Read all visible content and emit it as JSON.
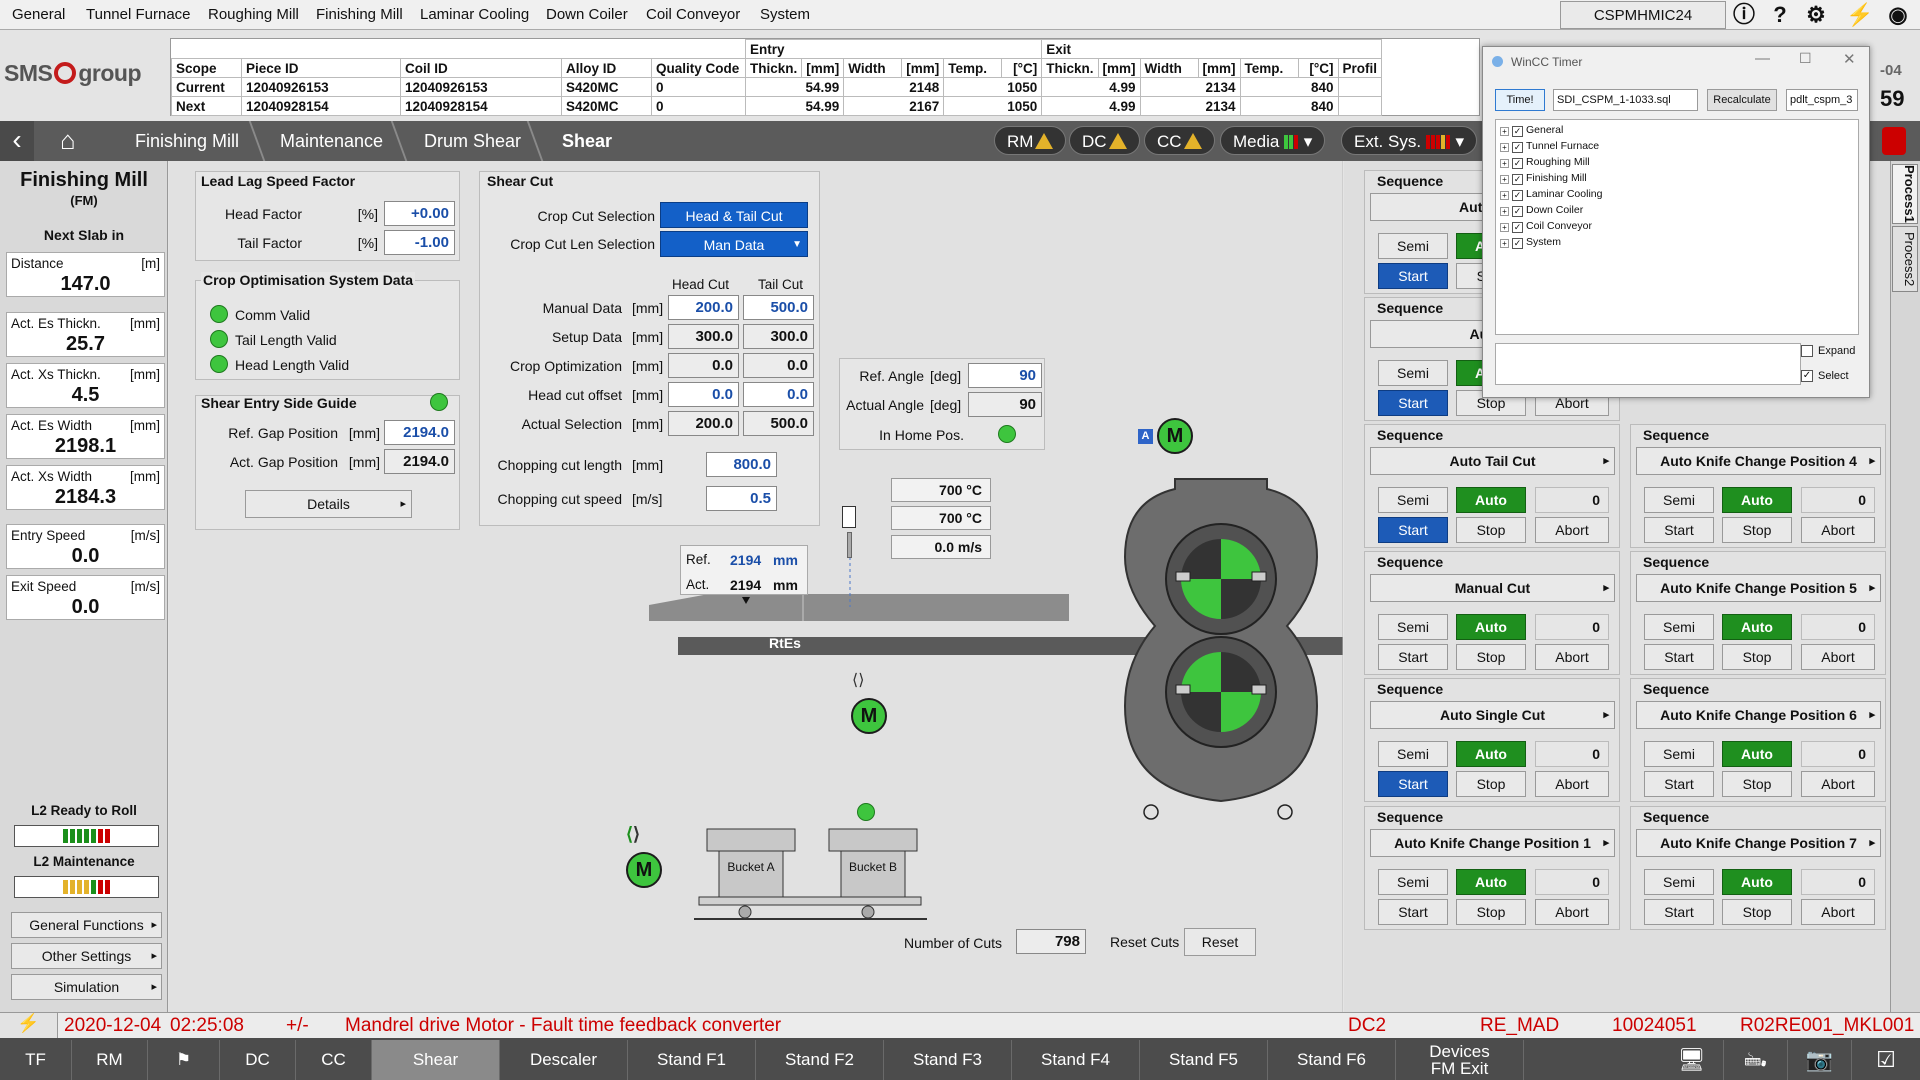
{
  "menu": [
    "General",
    "Tunnel Furnace",
    "Roughing Mill",
    "Finishing Mill",
    "Laminar Cooling",
    "Down Coiler",
    "Coil Conveyor",
    "System"
  ],
  "hostname": "CSPMHMIC24",
  "brand": {
    "name_left": "SMS",
    "name_right": "group"
  },
  "header_corner": {
    "line1": "-04",
    "line2": "59"
  },
  "pieces": {
    "group_entry": "Entry",
    "group_exit": "Exit",
    "cols": [
      "Scope",
      "Piece ID",
      "Coil ID",
      "Alloy ID",
      "Quality Code",
      "Thickn.",
      "[mm]",
      "Width",
      "[mm]",
      "Temp.",
      "[°C]",
      "Thickn.",
      "[mm]",
      "Width",
      "[mm]",
      "Temp.",
      "[°C]",
      "Profil"
    ],
    "rows": [
      {
        "scope": "Current",
        "piece": "12040926153",
        "coil": "12040926153",
        "alloy": "S420MC",
        "quality": "0",
        "en_th": "54.99",
        "en_w": "2148",
        "en_t": "1050",
        "ex_th": "4.99",
        "ex_w": "2134",
        "ex_t": "840"
      },
      {
        "scope": "Next",
        "piece": "12040928154",
        "coil": "12040928154",
        "alloy": "S420MC",
        "quality": "0",
        "en_th": "54.99",
        "en_w": "2167",
        "en_t": "1050",
        "ex_th": "4.99",
        "ex_w": "2134",
        "ex_t": "840"
      }
    ]
  },
  "breadcrumb": [
    "Finishing Mill",
    "Maintenance",
    "Drum Shear",
    "Shear"
  ],
  "status_buttons": {
    "rm": "RM",
    "dc": "DC",
    "cc": "CC",
    "media": "Media",
    "ext": "Ext. Sys."
  },
  "left": {
    "title": "Finishing Mill",
    "subtitle": "(FM)",
    "next_slab": "Next Slab in",
    "boxes": [
      {
        "label": "Distance",
        "unit": "[m]",
        "value": "147.0"
      },
      {
        "label": "Act. Es Thickn.",
        "unit": "[mm]",
        "value": "25.7"
      },
      {
        "label": "Act. Xs Thickn.",
        "unit": "[mm]",
        "value": "4.5"
      },
      {
        "label": "Act. Es Width",
        "unit": "[mm]",
        "value": "2198.1"
      },
      {
        "label": "Act. Xs Width",
        "unit": "[mm]",
        "value": "2184.3"
      },
      {
        "label": "Entry Speed",
        "unit": "[m/s]",
        "value": "0.0"
      },
      {
        "label": "Exit Speed",
        "unit": "[m/s]",
        "value": "0.0"
      }
    ],
    "l2_ready": "L2 Ready to Roll",
    "l2_maint": "L2 Maintenance",
    "buttons": [
      "General Functions",
      "Other Settings",
      "Simulation"
    ]
  },
  "leadlag": {
    "title": "Lead Lag Speed Factor",
    "head_label": "Head Factor",
    "tail_label": "Tail Factor",
    "unit": "[%]",
    "head": "+0.00",
    "tail": "-1.00"
  },
  "crop_opt": {
    "title": "Crop Optimisation System Data",
    "items": [
      "Comm Valid",
      "Tail Length Valid",
      "Head Length Valid"
    ]
  },
  "guide": {
    "title": "Shear Entry Side Guide",
    "ref_label": "Ref. Gap Position",
    "act_label": "Act. Gap Position",
    "unit": "[mm]",
    "ref": "2194.0",
    "act": "2194.0",
    "details": "Details"
  },
  "shearcut": {
    "title": "Shear Cut",
    "sel_label": "Crop Cut Selection",
    "sel_value": "Head & Tail Cut",
    "len_label": "Crop Cut Len Selection",
    "len_value": "Man Data",
    "col_head": "Head Cut",
    "col_tail": "Tail Cut",
    "rows": [
      {
        "label": "Manual Data",
        "unit": "[mm]",
        "head": "200.0",
        "tail": "500.0"
      },
      {
        "label": "Setup Data",
        "unit": "[mm]",
        "head": "300.0",
        "tail": "300.0"
      },
      {
        "label": "Crop Optimization",
        "unit": "[mm]",
        "head": "0.0",
        "tail": "0.0"
      },
      {
        "label": "Head cut offset",
        "unit": "[mm]",
        "head": "0.0",
        "tail": "0.0"
      },
      {
        "label": "Actual Selection",
        "unit": "[mm]",
        "head": "200.0",
        "tail": "500.0"
      }
    ],
    "chop_len_label": "Chopping cut length",
    "chop_len_unit": "[mm]",
    "chop_len": "800.0",
    "chop_spd_label": "Chopping cut speed",
    "chop_spd_unit": "[m/s]",
    "chop_spd": "0.5"
  },
  "angle": {
    "ref_label": "Ref. Angle",
    "act_label": "Actual Angle",
    "unit": "[deg]",
    "ref": "90",
    "act": "90",
    "home": "In Home Pos."
  },
  "process": {
    "temp1": "700 °C",
    "temp2": "700 °C",
    "speed": "0.0",
    "speed_unit": "m/s",
    "ref_label": "Ref.",
    "act_label": "Act.",
    "ref_val": "2194",
    "act_val": "2194",
    "mm": "mm",
    "rtes": "RtEs",
    "motor": "M",
    "bucket_a": "Bucket A",
    "bucket_b": "Bucket B",
    "motor_tag": "A",
    "cuts_label": "Number of Cuts",
    "cuts": "798",
    "reset_label": "Reset Cuts",
    "reset_btn": "Reset"
  },
  "sequences": [
    {
      "title": "Sequence",
      "name": "Auto Hom",
      "count": "",
      "start_blue": true
    },
    {
      "title": "Sequence",
      "name": "Auto H",
      "count": "",
      "start_blue": true
    },
    {
      "title": "Sequence",
      "name": "Auto Tail Cut",
      "count": "0",
      "start_blue": true
    },
    {
      "title": "Sequence",
      "name": "Auto Knife Change Position 4",
      "count": "0",
      "start_blue": false
    },
    {
      "title": "Sequence",
      "name": "Manual Cut",
      "count": "0",
      "start_blue": false
    },
    {
      "title": "Sequence",
      "name": "Auto Knife Change Position 5",
      "count": "0",
      "start_blue": false
    },
    {
      "title": "Sequence",
      "name": "Auto Single Cut",
      "count": "0",
      "start_blue": true
    },
    {
      "title": "Sequence",
      "name": "Auto Knife Change Position 6",
      "count": "0",
      "start_blue": false
    },
    {
      "title": "Sequence",
      "name": "Auto Knife Change Position 1",
      "count": "0",
      "start_blue": false
    },
    {
      "title": "Sequence",
      "name": "Auto Knife Change Position 7",
      "count": "0",
      "start_blue": false
    }
  ],
  "seq_buttons": {
    "semi": "Semi",
    "auto": "Auto",
    "start": "Start",
    "stop": "Stop",
    "abort": "Abort"
  },
  "side_tabs": [
    "Process1",
    "Process2"
  ],
  "timer": {
    "title": "WinCC Timer",
    "time_btn": "Time!",
    "file": "SDI_CSPM_1-1033.sql",
    "recalc": "Recalculate",
    "db": "pdlt_cspm_3",
    "tree": [
      "General",
      "Tunnel Furnace",
      "Roughing Mill",
      "Finishing Mill",
      "Laminar Cooling",
      "Down Coiler",
      "Coil Conveyor",
      "System"
    ],
    "expand": "Expand",
    "select": "Select"
  },
  "alarm": {
    "date": "2020-12-04",
    "time": "02:25:08",
    "sign": "+/-",
    "text": "Mandrel drive Motor - Fault time feedback converter",
    "code1": "DC2",
    "code2": "RE_MAD",
    "code3": "10024051",
    "code4": "R02RE001_MKL001"
  },
  "taskbar": [
    "TF",
    "RM",
    "",
    "DC",
    "CC",
    "Shear",
    "Descaler",
    "Stand F1",
    "Stand F2",
    "Stand F3",
    "Stand F4",
    "Stand F5",
    "Stand F6"
  ],
  "taskbar_devices": {
    "line1": "Devices",
    "line2": "FM Exit"
  },
  "colors": {
    "accent_blue": "#1360c8",
    "led_green": "#3ec53e",
    "alarm_red": "#cc0000",
    "auto_green": "#1f8f1f"
  }
}
